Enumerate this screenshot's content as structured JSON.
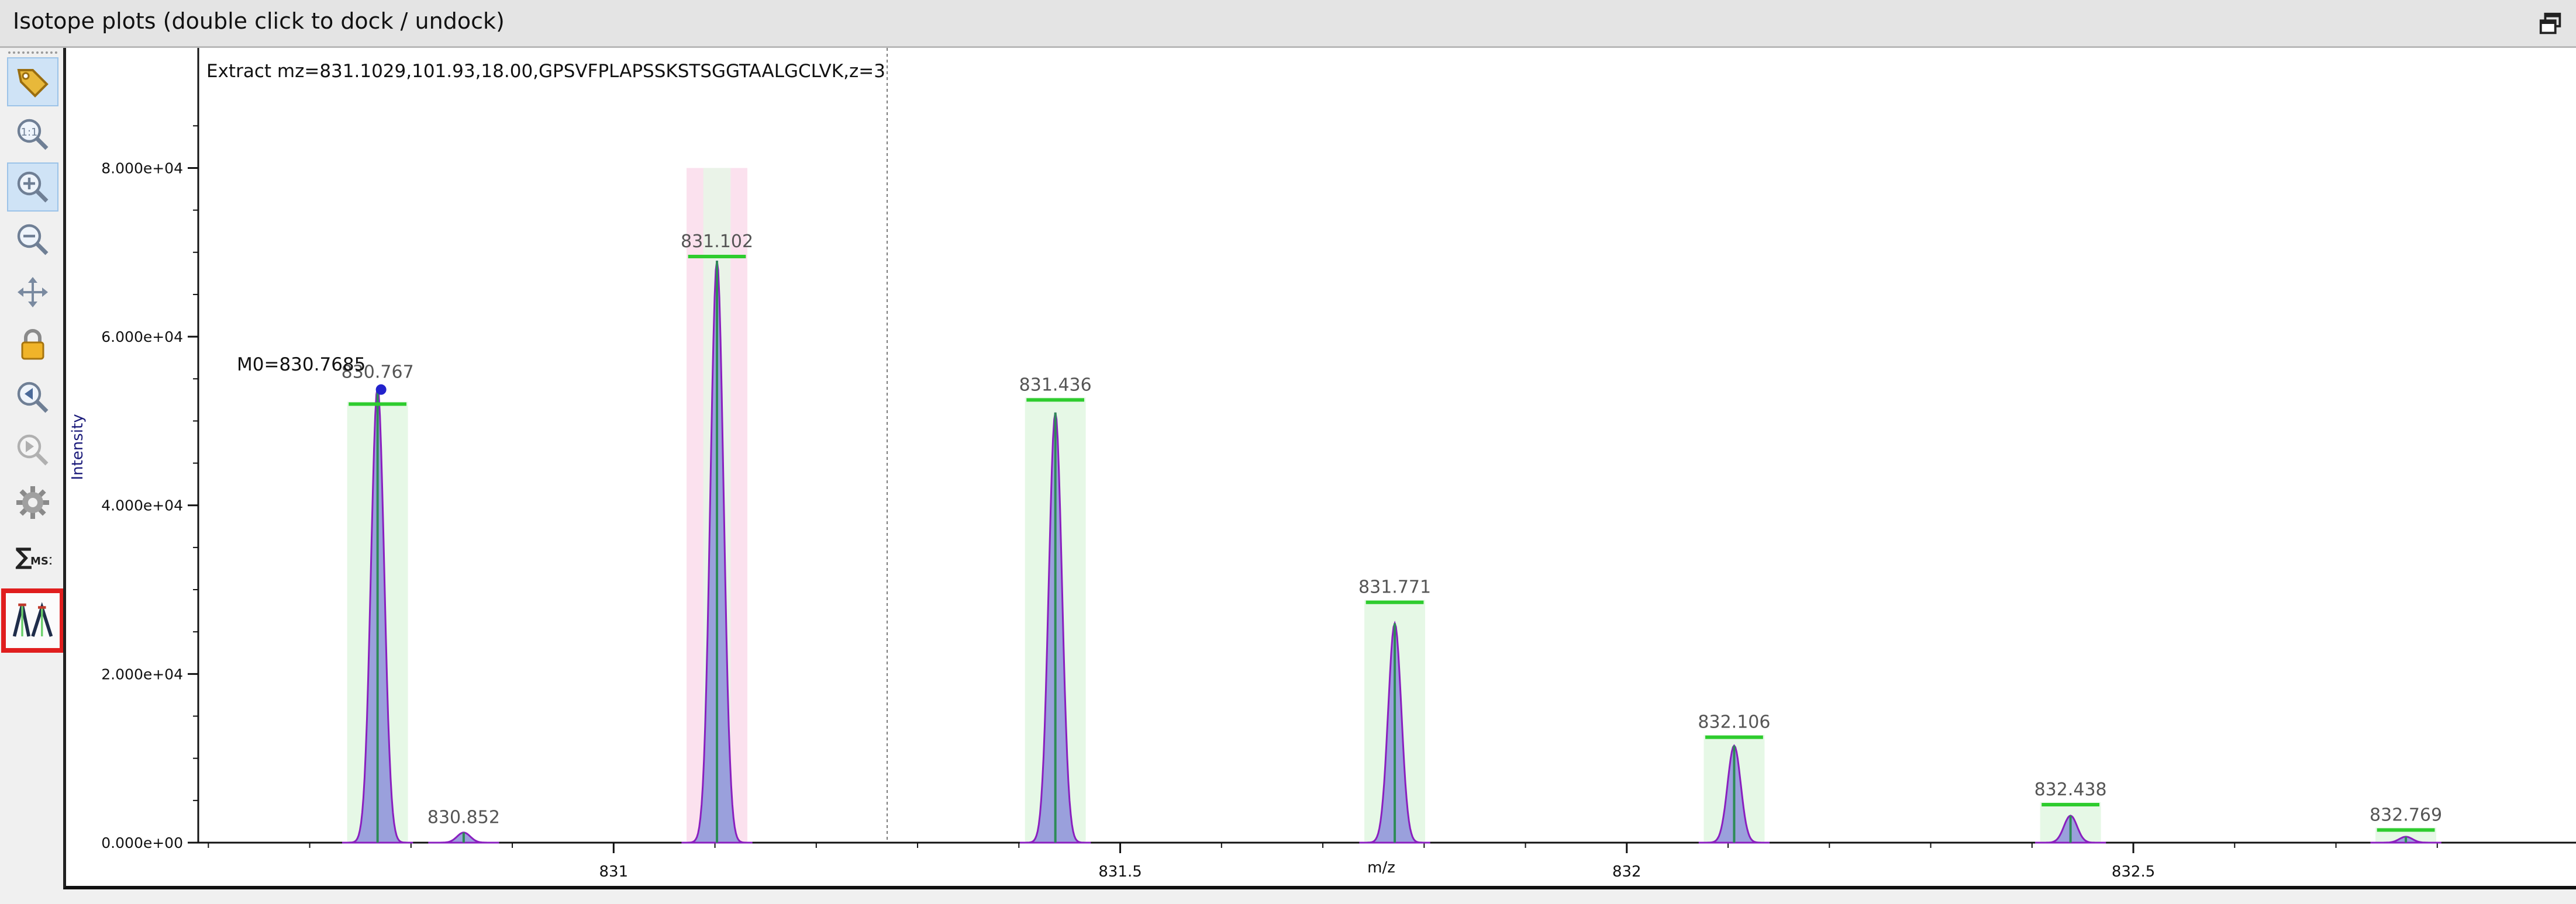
{
  "window": {
    "title": "Isotope plots (double click to dock / undock)"
  },
  "toolbar": {
    "items": [
      {
        "name": "tag-icon",
        "active": true
      },
      {
        "name": "zoom-reset-icon",
        "active": false
      },
      {
        "name": "zoom-in-icon",
        "active": true
      },
      {
        "name": "zoom-out-icon",
        "active": false
      },
      {
        "name": "pan-icon",
        "active": false
      },
      {
        "name": "lock-icon",
        "active": false
      },
      {
        "name": "zoom-previous-icon",
        "active": false
      },
      {
        "name": "zoom-next-icon",
        "active": false
      },
      {
        "name": "gear-icon",
        "active": false
      },
      {
        "name": "sum-ms1-icon",
        "active": false
      },
      {
        "name": "isotope-peaks-icon",
        "active": false,
        "highlighted": true
      }
    ],
    "sum_ms1_label": "MS1"
  },
  "plot": {
    "extract_label": "Extract mz=831.1029,101.93,18.00,GPSVFPLAPSSKSTSGGTAALGCLVK,z=3",
    "m0_label": "M0=830.7685",
    "colors": {
      "peak_fill": "#9aa0dc",
      "peak_outline": "#8a1fbf",
      "centroid_line": "#2e8b57",
      "intensity_bar": "#2ecc2e",
      "highlight_band": "#e6f8e6",
      "selected_band": "#fbe1ee",
      "axis_label": "#1a1a7a"
    }
  },
  "chart_data": {
    "type": "line",
    "xlabel": "m/z",
    "ylabel": "Intensity",
    "xlim": [
      830.59,
      832.93
    ],
    "ylim": [
      0,
      88000
    ],
    "x_ticks": [
      831,
      831.5,
      832,
      832.5
    ],
    "x_tick_labels": [
      "831",
      "831.5",
      "832",
      "832.5"
    ],
    "y_ticks": [
      0,
      20000,
      40000,
      60000,
      80000
    ],
    "y_tick_labels": [
      "0.000e+00",
      "2.000e+04",
      "4.000e+04",
      "6.000e+04",
      "8.000e+04"
    ],
    "dashed_vline_x": 831.27,
    "peaks": [
      {
        "mz": 830.767,
        "label": "830.767",
        "intensity": 54000,
        "theoretical": 52000
      },
      {
        "mz": 830.852,
        "label": "830.852",
        "intensity": 1200,
        "theoretical": null
      },
      {
        "mz": 831.102,
        "label": "831.102",
        "intensity": 69000,
        "theoretical": 69500
      },
      {
        "mz": 831.436,
        "label": "831.436",
        "intensity": 51000,
        "theoretical": 52500
      },
      {
        "mz": 831.771,
        "label": "831.771",
        "intensity": 26000,
        "theoretical": 28500
      },
      {
        "mz": 832.106,
        "label": "832.106",
        "intensity": 11500,
        "theoretical": 12500
      },
      {
        "mz": 832.438,
        "label": "832.438",
        "intensity": 3200,
        "theoretical": 4500
      },
      {
        "mz": 832.769,
        "label": "832.769",
        "intensity": 700,
        "theoretical": 1500
      }
    ]
  }
}
